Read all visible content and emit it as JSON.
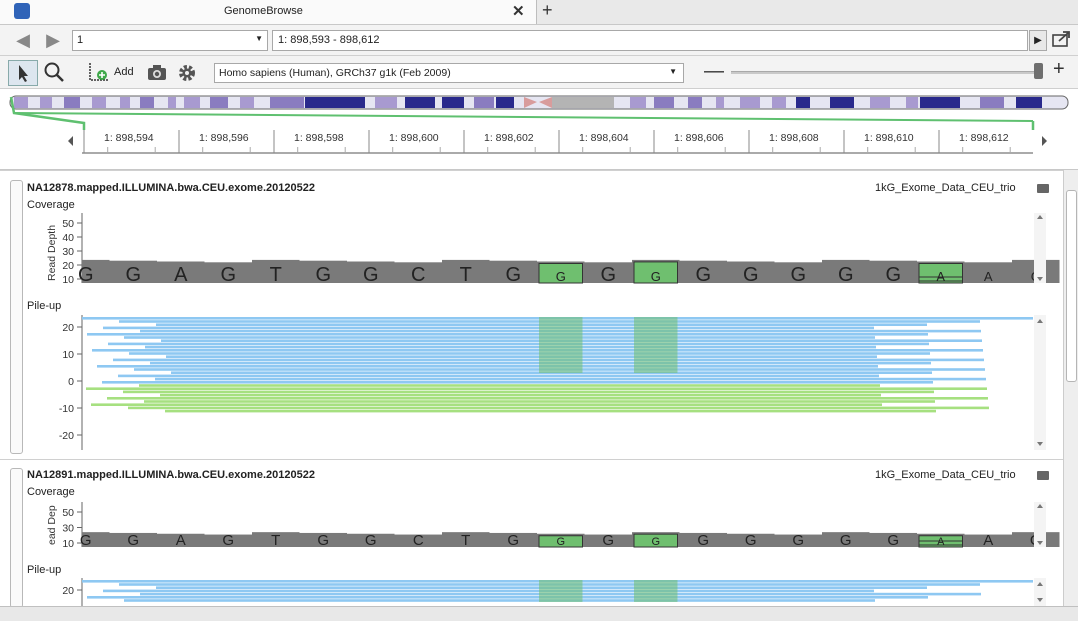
{
  "window": {
    "title": "GenomeBrowse"
  },
  "nav": {
    "chromosome": "1",
    "locus": "1: 898,593 - 898,612"
  },
  "toolbar": {
    "add_label": "Add",
    "genome": "Homo sapiens (Human), GRCh37 g1k (Feb 2009)"
  },
  "ruler": {
    "ticks": [
      "1: 898,594",
      "1: 898,596",
      "1: 898,598",
      "1: 898,600",
      "1: 898,602",
      "1: 898,604",
      "1: 898,606",
      "1: 898,608",
      "1: 898,610",
      "1: 898,612"
    ]
  },
  "reference_bases": [
    "G",
    "G",
    "A",
    "G",
    "T",
    "G",
    "G",
    "C",
    "T",
    "G",
    "G",
    "G",
    "G",
    "G",
    "G",
    "G",
    "G",
    "G",
    "A",
    "A",
    "G"
  ],
  "tracks": [
    {
      "title": "NA12878.mapped.ILLUMINA.bwa.CEU.exome.20120522",
      "source": "1kG_Exome_Data_CEU_trio",
      "coverage_label": "Coverage",
      "axis_label": "Read Depth",
      "coverage_ticks": [
        "50",
        "40",
        "30",
        "20",
        "10"
      ],
      "pileup_label": "Pile-up",
      "pileup_ticks": [
        "20",
        "10",
        "0",
        "-10",
        "-20"
      ]
    },
    {
      "title": "NA12891.mapped.ILLUMINA.bwa.CEU.exome.20120522",
      "source": "1kG_Exome_Data_CEU_trio",
      "coverage_label": "Coverage",
      "axis_label": "ead Dep",
      "coverage_ticks": [
        "50",
        "30",
        "10"
      ],
      "pileup_label": "Pile-up",
      "pileup_ticks": [
        "20"
      ]
    }
  ],
  "colors": {
    "forward_read": "#8ec8f2",
    "reverse_read": "#a6e080",
    "variant": "#6fbf6f",
    "coverage": "#7a7a7a",
    "ideogram_dark": "#2a2a8c"
  }
}
